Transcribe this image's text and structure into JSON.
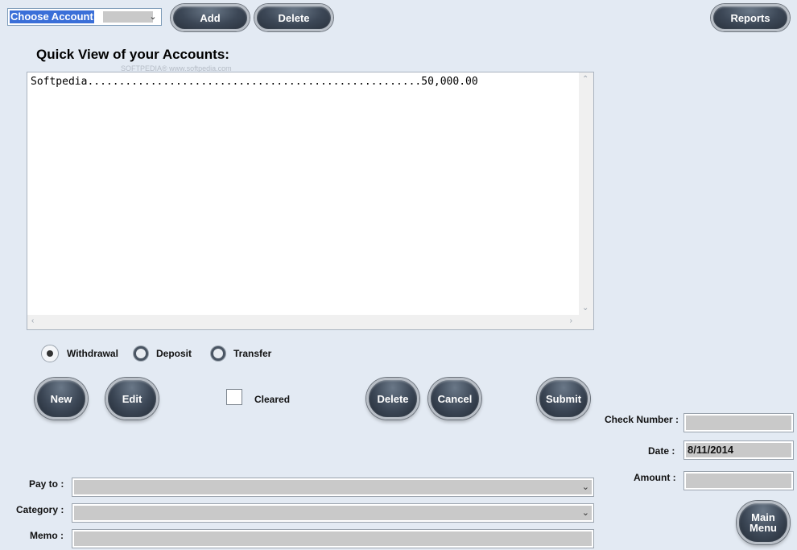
{
  "toolbar": {
    "account_select": {
      "value": "Choose Account"
    },
    "add_label": "Add",
    "delete_label": "Delete",
    "reports_label": "Reports"
  },
  "heading": "Quick View of your Accounts:",
  "watermark": "SOFTPEDIA®   www.softpedia.com",
  "accounts_list": [
    {
      "text": "Softpedia.....................................................50,000.00"
    }
  ],
  "transaction_type": {
    "options": [
      "Withdrawal",
      "Deposit",
      "Transfer"
    ],
    "selected": "Withdrawal"
  },
  "actions": {
    "new_label": "New",
    "edit_label": "Edit",
    "cleared_label": "Cleared",
    "delete_label": "Delete",
    "cancel_label": "Cancel",
    "submit_label": "Submit"
  },
  "form": {
    "check_number_label": "Check Number :",
    "check_number_value": "",
    "date_label": "Date :",
    "date_value": "8/11/2014",
    "amount_label": "Amount :",
    "amount_value": "",
    "payto_label": "Pay to :",
    "category_label": "Category :",
    "memo_label": "Memo :"
  },
  "main_menu": {
    "line1": "Main",
    "line2": "Menu"
  },
  "icons": {
    "dropdown": "chevron-down-icon",
    "scroll_up": "chevron-up-icon",
    "scroll_down": "chevron-down-icon",
    "scroll_left": "chevron-left-icon",
    "scroll_right": "chevron-right-icon"
  },
  "colors": {
    "background": "#e3eaf3",
    "button_dark": "#3c4756",
    "selection": "#3a6fd8",
    "field_grey": "#c9c9c9"
  }
}
